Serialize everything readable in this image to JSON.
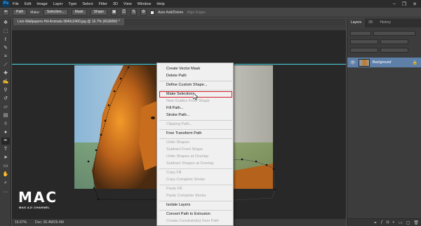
{
  "app": {
    "logo_text": "Ps"
  },
  "menubar": {
    "items": [
      "File",
      "Edit",
      "Image",
      "Layer",
      "Type",
      "Select",
      "Filter",
      "3D",
      "View",
      "Window",
      "Help"
    ]
  },
  "options_bar": {
    "mode": "Path",
    "make_label": "Make:",
    "selection_btn": "Selection...",
    "mask_btn": "Mask",
    "shape_btn": "Shape",
    "auto_add_delete": "Auto Add/Delete",
    "align_edges": "Align Edges"
  },
  "document": {
    "tab_title": "Lion-Wallpapers-Hd-Animals-3840x2400.jpg @ 16.7% (RGB/8#) *",
    "zoom": "16.67%",
    "doc_size": "Doc: 26.4M/26.4M"
  },
  "panel": {
    "tabs": [
      "Layers",
      "3D",
      "History"
    ],
    "layer_name": "Background"
  },
  "context_menu": {
    "items": [
      {
        "label": "Create Vector Mask",
        "disabled": false
      },
      {
        "label": "Delete Path",
        "disabled": false
      },
      {
        "label": "Define Custom Shape...",
        "disabled": false
      },
      {
        "label": "Make Selection...",
        "disabled": false,
        "highlighted": true
      },
      {
        "label": "New Guides From Shape",
        "disabled": true
      },
      {
        "label": "Fill Path...",
        "disabled": false
      },
      {
        "label": "Stroke Path...",
        "disabled": false
      },
      {
        "label": "Clipping Path...",
        "disabled": true
      },
      {
        "label": "Free Transform Path",
        "disabled": false
      },
      {
        "label": "Unite Shapes",
        "disabled": true
      },
      {
        "label": "Subtract Front Shape",
        "disabled": true
      },
      {
        "label": "Unite Shapes at Overlap",
        "disabled": true
      },
      {
        "label": "Subtract Shapes at Overlap",
        "disabled": true
      },
      {
        "label": "Copy Fill",
        "disabled": true
      },
      {
        "label": "Copy Complete Stroke",
        "disabled": true
      },
      {
        "label": "Paste Fill",
        "disabled": true
      },
      {
        "label": "Paste Complete Stroke",
        "disabled": true
      },
      {
        "label": "Isolate Layers",
        "disabled": false
      },
      {
        "label": "Convert Path to Extrusion",
        "disabled": false
      },
      {
        "label": "Create Constraint(s) from Path",
        "disabled": true
      }
    ]
  },
  "watermark": {
    "main": "MAC",
    "sub": "MAS AJI CHANNEL"
  },
  "colors": {
    "guide": "#4bd6e0",
    "highlight_box": "#d21f2a",
    "layer_selected": "#5d7fa8"
  }
}
